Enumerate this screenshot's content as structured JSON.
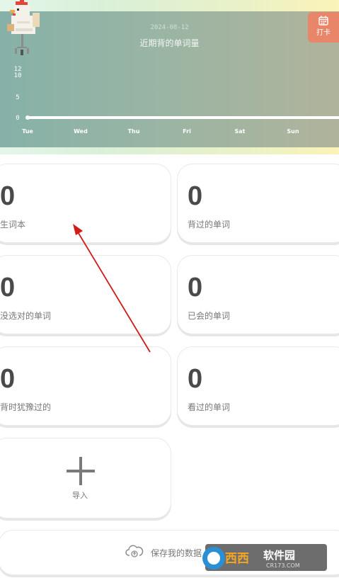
{
  "chart": {
    "date": "2024-08-12",
    "title": "近期背的单词量",
    "y_ticks": [
      "12",
      "10",
      "5",
      "0"
    ],
    "days": [
      "Tue",
      "Wed",
      "Thu",
      "Fri",
      "Sat",
      "Sun"
    ]
  },
  "chart_data": {
    "type": "line",
    "title": "近期背的单词量",
    "categories": [
      "Tue",
      "Wed",
      "Thu",
      "Fri",
      "Sat",
      "Sun"
    ],
    "values": [
      0,
      0,
      0,
      0,
      0,
      0,
      0
    ],
    "ylim": [
      0,
      12
    ],
    "grid": false
  },
  "checkin": {
    "label": "打卡"
  },
  "cards": [
    {
      "count": "0",
      "label": "生词本"
    },
    {
      "count": "0",
      "label": "背过的单词"
    },
    {
      "count": "0",
      "label": "没选对的单词"
    },
    {
      "count": "0",
      "label": "已会的单词"
    },
    {
      "count": "0",
      "label": "背时犹豫过的"
    },
    {
      "count": "0",
      "label": "看过的单词"
    }
  ],
  "import": {
    "label": "导入"
  },
  "save": {
    "label": "保存我的数据"
  },
  "watermark": {
    "brand": "西西软件园",
    "site": "CR173.COM"
  },
  "colors": {
    "accent": "#e9866a",
    "arrow": "#d11a1a",
    "text": "#4a4a4a"
  }
}
